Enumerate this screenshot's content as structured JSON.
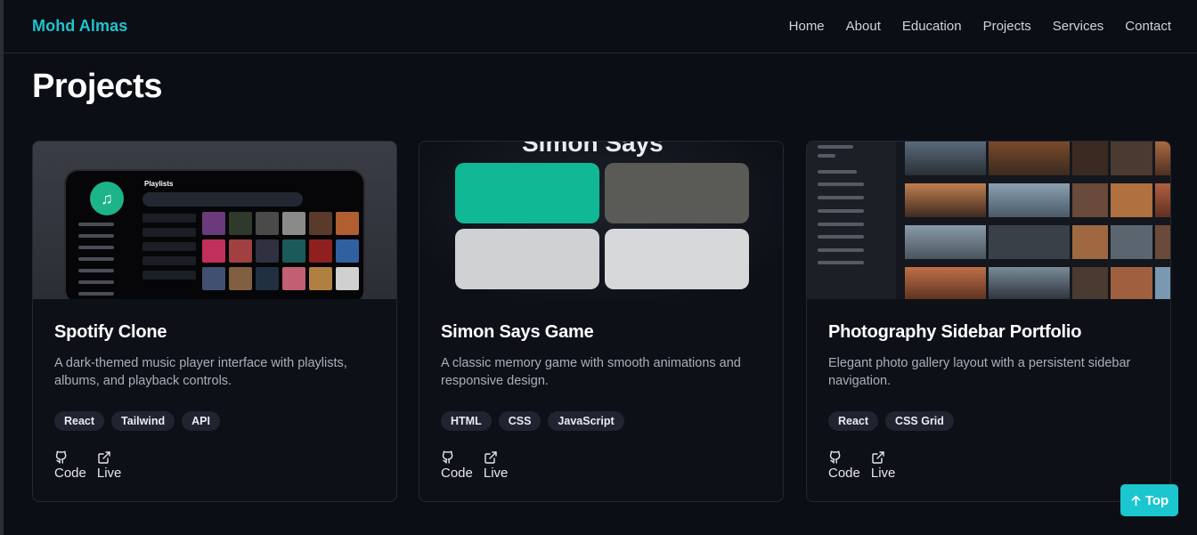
{
  "brand": "Mohd Almas",
  "nav": [
    "Home",
    "About",
    "Education",
    "Projects",
    "Services",
    "Contact"
  ],
  "page_title": "Projects",
  "cards": [
    {
      "title": "Spotify Clone",
      "description": "A dark-themed music player interface with playlists, albums, and playback controls.",
      "tags": [
        "React",
        "Tailwind",
        "API"
      ],
      "thumb": {
        "header": "Playlists"
      },
      "links": {
        "code": "Code",
        "live": "Live"
      }
    },
    {
      "title": "Simon Says Game",
      "description": "A classic memory game with smooth animations and responsive design.",
      "tags": [
        "HTML",
        "CSS",
        "JavaScript"
      ],
      "thumb": {
        "header": "Simon Says"
      },
      "links": {
        "code": "Code",
        "live": "Live"
      }
    },
    {
      "title": "Photography Sidebar Portfolio",
      "description": "Elegant photo gallery layout with a persistent sidebar navigation.",
      "tags": [
        "React",
        "CSS Grid"
      ],
      "thumb": {
        "header": ""
      },
      "links": {
        "code": "Code",
        "live": "Live"
      }
    }
  ],
  "top_button": {
    "label": "Top",
    "icon": "arrow-up-icon"
  },
  "colors": {
    "accent": "#1fc3d0",
    "background": "#0b0e14",
    "simon_green": "#10b896",
    "simon_gray": "#5a5b57",
    "simon_light": "#cfd1d3"
  }
}
